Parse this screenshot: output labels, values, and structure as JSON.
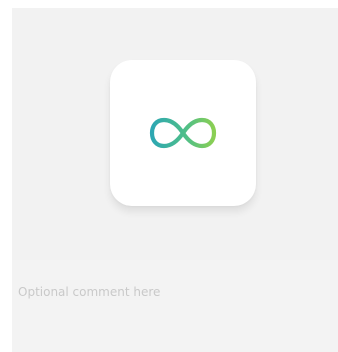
{
  "preview": {
    "icon_name": "infinity-icon",
    "gradient": [
      "#2da7b2",
      "#8bcf53"
    ]
  },
  "comment": {
    "placeholder": "Optional comment here"
  }
}
